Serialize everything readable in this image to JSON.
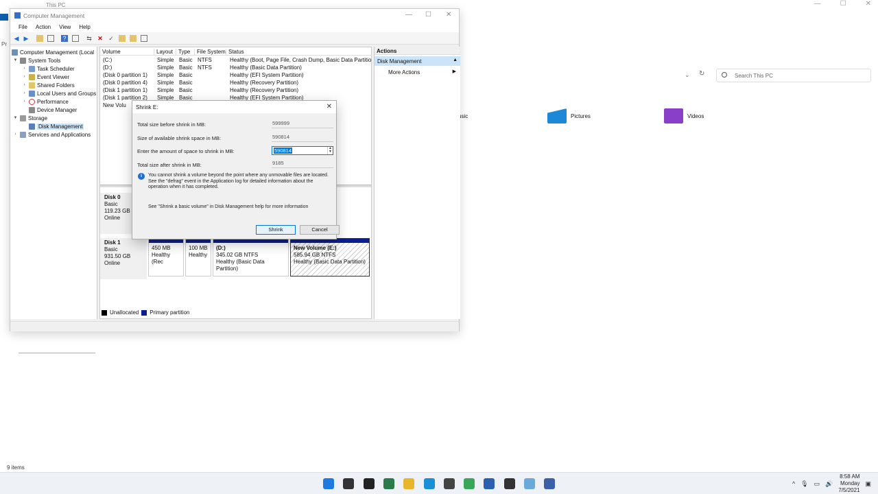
{
  "explorer": {
    "title": "This PC",
    "search_placeholder": "Search This PC",
    "folders": [
      {
        "label": "usic",
        "icon": "music-folder-icon"
      },
      {
        "label": "Pictures",
        "icon": "pictures-folder-icon"
      },
      {
        "label": "Videos",
        "icon": "videos-folder-icon"
      }
    ],
    "status": "9 items",
    "left_fragment": "Pr"
  },
  "cm": {
    "title": "Computer Management",
    "menu": [
      "File",
      "Action",
      "View",
      "Help"
    ],
    "tree": {
      "root": "Computer Management (Local",
      "system_tools": "System Tools",
      "task_scheduler": "Task Scheduler",
      "event_viewer": "Event Viewer",
      "shared_folders": "Shared Folders",
      "local_users": "Local Users and Groups",
      "performance": "Performance",
      "device_manager": "Device Manager",
      "storage": "Storage",
      "disk_management": "Disk Management",
      "services": "Services and Applications"
    },
    "columns": [
      "Volume",
      "Layout",
      "Type",
      "File System",
      "Status"
    ],
    "volumes": [
      {
        "name": "(C:)",
        "layout": "Simple",
        "type": "Basic",
        "fs": "NTFS",
        "status": "Healthy (Boot, Page File, Crash Dump, Basic Data Partition)"
      },
      {
        "name": "(D:)",
        "layout": "Simple",
        "type": "Basic",
        "fs": "NTFS",
        "status": "Healthy (Basic Data Partition)"
      },
      {
        "name": "(Disk 0 partition 1)",
        "layout": "Simple",
        "type": "Basic",
        "fs": "",
        "status": "Healthy (EFI System Partition)"
      },
      {
        "name": "(Disk 0 partition 4)",
        "layout": "Simple",
        "type": "Basic",
        "fs": "",
        "status": "Healthy (Recovery Partition)"
      },
      {
        "name": "(Disk 1 partition 1)",
        "layout": "Simple",
        "type": "Basic",
        "fs": "",
        "status": "Healthy (Recovery Partition)"
      },
      {
        "name": "(Disk 1 partition 2)",
        "layout": "Simple",
        "type": "Basic",
        "fs": "",
        "status": "Healthy (EFI System Partition)"
      },
      {
        "name": "New Volu",
        "layout": "",
        "type": "",
        "fs": "",
        "status": ""
      }
    ],
    "disk0": {
      "name": "Disk 0",
      "type": "Basic",
      "size": "119.23 GB",
      "state": "Online"
    },
    "disk1": {
      "name": "Disk 1",
      "type": "Basic",
      "size": "931.50 GB",
      "state": "Online",
      "parts": [
        {
          "l1": "",
          "l2": "450 MB",
          "l3": "Healthy (Rec"
        },
        {
          "l1": "",
          "l2": "100 MB",
          "l3": "Healthy"
        },
        {
          "l1": "(D:)",
          "l2": "345.02 GB NTFS",
          "l3": "Healthy (Basic Data Partition)"
        },
        {
          "l1": "New Volume  (E:)",
          "l2": "585.94 GB NTFS",
          "l3": "Healthy (Basic Data Partition)"
        }
      ]
    },
    "legend": {
      "unallocated": "Unallocated",
      "primary": "Primary partition",
      "unallocated_color": "#000000",
      "primary_color": "#0b1f8f"
    },
    "actions": {
      "header": "Actions",
      "disk_mgmt": "Disk Management",
      "more": "More Actions"
    }
  },
  "dialog": {
    "title": "Shrink E:",
    "total_label": "Total size before shrink in MB:",
    "total_value": "599999",
    "avail_label": "Size of available shrink space in MB:",
    "avail_value": "590814",
    "enter_label": "Enter the amount of space to shrink in MB:",
    "enter_value": "590814",
    "after_label": "Total size after shrink in MB:",
    "after_value": "9185",
    "info": "You cannot shrink a volume beyond the point where any unmovable files are located. See the \"defrag\" event in the Application log for detailed information about the operation when it has completed.",
    "help": "See \"Shrink a basic volume\" in Disk Management help for more information",
    "shrink": "Shrink",
    "cancel": "Cancel"
  },
  "taskbar": {
    "time": "8:58 AM",
    "day": "Monday",
    "date": "7/5/2021",
    "icons": [
      "windows-start-icon",
      "search-icon",
      "task-view-icon",
      "widgets-icon",
      "file-explorer-icon",
      "edge-icon",
      "store-icon",
      "torrent-icon",
      "app-icon",
      "obs-icon",
      "photos-icon",
      "computer-management-icon"
    ]
  }
}
